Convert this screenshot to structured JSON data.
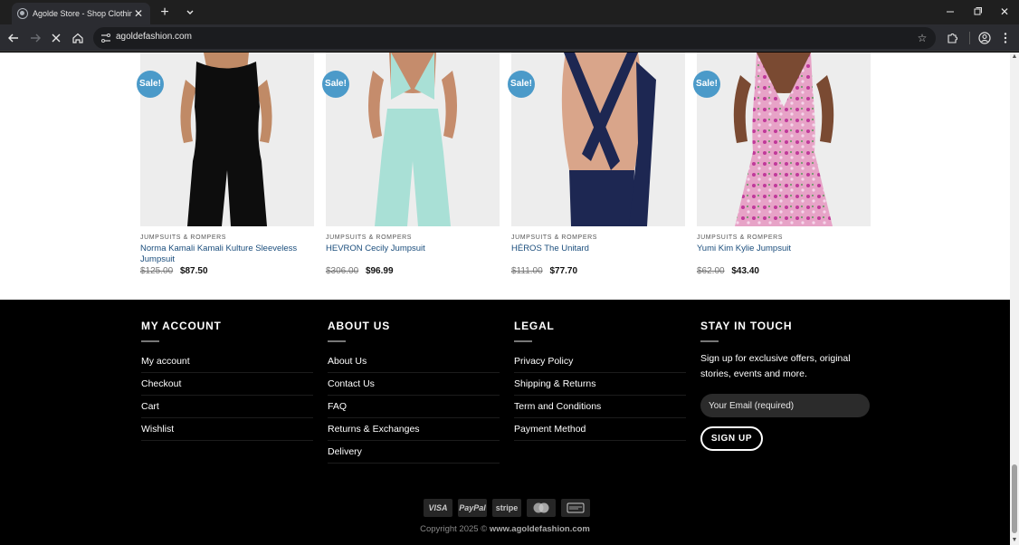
{
  "browser": {
    "tab_title": "Agolde Store - Shop Clothing Online",
    "url": "agoldefashion.com",
    "icons": {
      "back": "back-arrow-icon",
      "forward": "forward-arrow-icon",
      "stop": "stop-loading-icon",
      "home": "home-icon",
      "bookmark": "star-icon",
      "extensions": "puzzle-icon",
      "profile": "profile-icon",
      "menu": "kebab-menu-icon"
    }
  },
  "products": [
    {
      "badge": "Sale!",
      "category": "JUMPSUITS & ROMPERS",
      "name": "Norma Kamali Kamali Kulture Sleeveless Jumpsuit",
      "old_price": "$125.00",
      "price": "$87.50",
      "garment_color": "#0d0d0d",
      "skin_color": "#c08a66"
    },
    {
      "badge": "Sale!",
      "category": "JUMPSUITS & ROMPERS",
      "name": "HEVRON Cecily Jumpsuit",
      "old_price": "$306.00",
      "price": "$96.99",
      "garment_color": "#a9e0d6",
      "skin_color": "#c58c6c"
    },
    {
      "badge": "Sale!",
      "category": "JUMPSUITS & ROMPERS",
      "name": "HÉROS The Unitard",
      "old_price": "$111.00",
      "price": "$77.70",
      "garment_color": "#1d2752",
      "skin_color": "#d9a58a"
    },
    {
      "badge": "Sale!",
      "category": "JUMPSUITS & ROMPERS",
      "name": "Yumi Kim Kylie Jumpsuit",
      "old_price": "$62.00",
      "price": "$43.40",
      "garment_color": "#e7a3c7",
      "skin_color": "#7a4a32"
    }
  ],
  "footer": {
    "my_account": {
      "heading": "MY ACCOUNT",
      "links": [
        "My account",
        "Checkout",
        "Cart",
        "Wishlist"
      ]
    },
    "about_us": {
      "heading": "ABOUT US",
      "links": [
        "About Us",
        "Contact Us",
        "FAQ",
        "Returns & Exchanges",
        "Delivery"
      ]
    },
    "legal": {
      "heading": "LEGAL",
      "links": [
        "Privacy Policy",
        "Shipping & Returns",
        "Term and Conditions",
        "Payment Method"
      ]
    },
    "stay_in_touch": {
      "heading": "STAY IN TOUCH",
      "text": "Sign up for exclusive offers, original stories, events and more.",
      "email_placeholder": "Your Email (required)",
      "signup_label": "SIGN UP"
    },
    "payment_methods": [
      "VISA",
      "PayPal",
      "stripe",
      "mastercard-icon",
      "cash-on-delivery-icon"
    ],
    "copyright_prefix": "Copyright 2025 © ",
    "copyright_site": "www.agoldefashion.com"
  },
  "colors": {
    "sale_badge": "#4b9ac9",
    "product_link": "#1a4d7c",
    "footer_bg": "#000000"
  }
}
